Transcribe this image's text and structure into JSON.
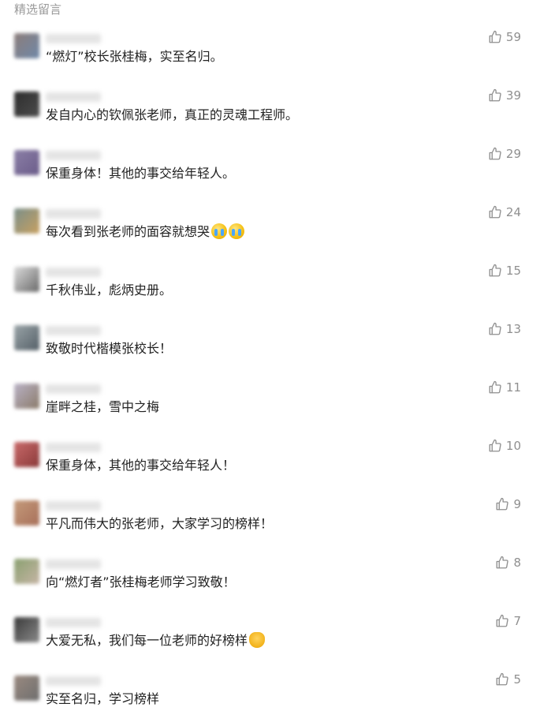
{
  "section": {
    "title": "精选留言"
  },
  "comments": [
    {
      "text": "“燃灯”校长张桂梅，实至名归。",
      "likes": "59",
      "avatar_colors": [
        "#8c7d7a",
        "#6f88a8"
      ]
    },
    {
      "text": "发自内心的钦佩张老师，真正的灵魂工程师。",
      "likes": "39",
      "avatar_colors": [
        "#2d2d2d",
        "#4c4c4c"
      ]
    },
    {
      "text": "保重身体！其他的事交给年轻人。",
      "likes": "29",
      "avatar_colors": [
        "#8b7fa6",
        "#6b5c8a"
      ]
    },
    {
      "text": "每次看到张老师的面容就想哭",
      "likes": "24",
      "avatar_colors": [
        "#7a8f8a",
        "#c8a060"
      ]
    },
    {
      "text": "千秋伟业，彪炳史册。",
      "likes": "15",
      "avatar_colors": [
        "#dcdcdc",
        "#6a6a6a"
      ]
    },
    {
      "text": "致敬时代楷模张校长！",
      "likes": "13",
      "avatar_colors": [
        "#9aa4a8",
        "#556068"
      ]
    },
    {
      "text": "崖畔之桂，雪中之梅",
      "likes": "11",
      "avatar_colors": [
        "#b9b2c6",
        "#8b7b6a"
      ]
    },
    {
      "text": "保重身体，其他的事交给年轻人！",
      "likes": "10",
      "avatar_colors": [
        "#c96a6a",
        "#8a3a3a"
      ]
    },
    {
      "text": "平凡而伟大的张老师，大家学习的榜样！",
      "likes": "9",
      "avatar_colors": [
        "#c49a7a",
        "#a8705a"
      ]
    },
    {
      "text": "向“燃灯者”张桂梅老师学习致敬！",
      "likes": "8",
      "avatar_colors": [
        "#8aa070",
        "#c6b5a5"
      ]
    },
    {
      "text": "大爱无私，我们每一位老师的好榜样",
      "likes": "7",
      "avatar_colors": [
        "#3a3a3a",
        "#8a8a8a"
      ]
    },
    {
      "text": "实至名归，学习榜样",
      "likes": "5",
      "avatar_colors": [
        "#9a8a80",
        "#6e6e6e"
      ]
    }
  ],
  "emoji": {
    "cry_comment_index": 3,
    "clap_comment_index": 10
  },
  "colors": {
    "text": "#222222",
    "muted": "#9a9a9a",
    "like": "#8f8f8f"
  },
  "icons": {
    "like": "thumbs-up-icon"
  }
}
